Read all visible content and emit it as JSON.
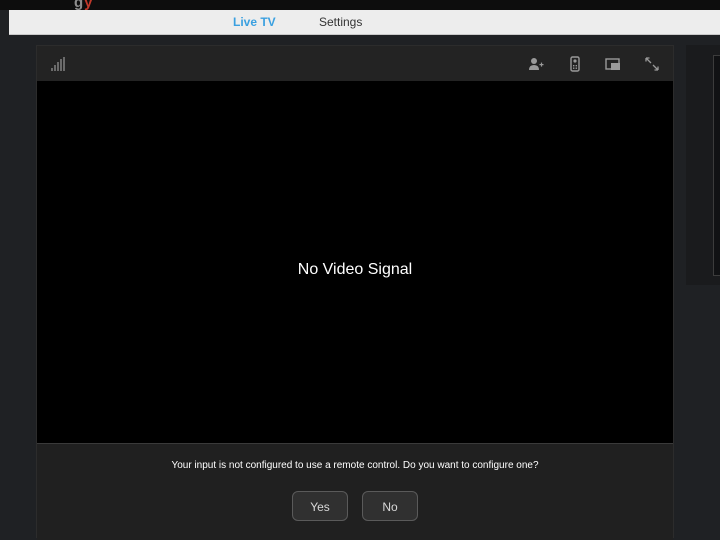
{
  "nav": {
    "tabs": [
      {
        "label": "Live TV",
        "active": true
      },
      {
        "label": "Settings",
        "active": false
      }
    ],
    "accent_color": "#3aa0e0"
  },
  "player": {
    "toolbar": {
      "icons": [
        "signal-strength-icon",
        "add-user-icon",
        "remote-control-icon",
        "picture-in-picture-icon",
        "fullscreen-icon"
      ]
    },
    "video_message": "No Video Signal",
    "prompt": {
      "text": "Your input is not configured to use a remote control. Do you want to configure one?",
      "yes_label": "Yes",
      "no_label": "No"
    }
  }
}
